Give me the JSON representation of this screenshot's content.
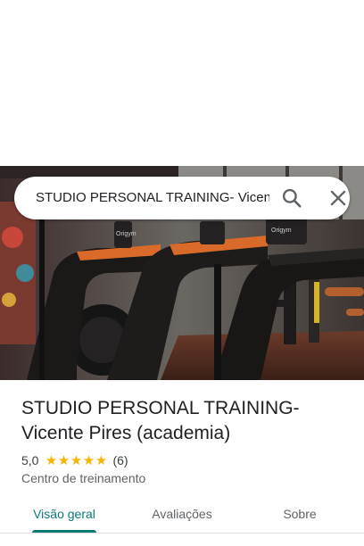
{
  "search": {
    "query": "STUDIO PERSONAL TRAINING- Vicente Pires (academia)"
  },
  "place": {
    "title_line1": "STUDIO PERSONAL TRAINING-",
    "title_line2": "Vicente Pires (academia)",
    "rating": "5,0",
    "review_count": "(6)",
    "stars": 5,
    "category": "Centro de treinamento"
  },
  "photo": {
    "brand_label": "Origym"
  },
  "tabs": [
    {
      "label": "Visão geral",
      "active": true
    },
    {
      "label": "Avaliações",
      "active": false
    },
    {
      "label": "Sobre",
      "active": false
    }
  ],
  "colors": {
    "accent": "#0b7a74",
    "star": "#f6b400"
  },
  "icons": {
    "search": "search-icon",
    "close": "close-icon",
    "star": "star-icon"
  }
}
